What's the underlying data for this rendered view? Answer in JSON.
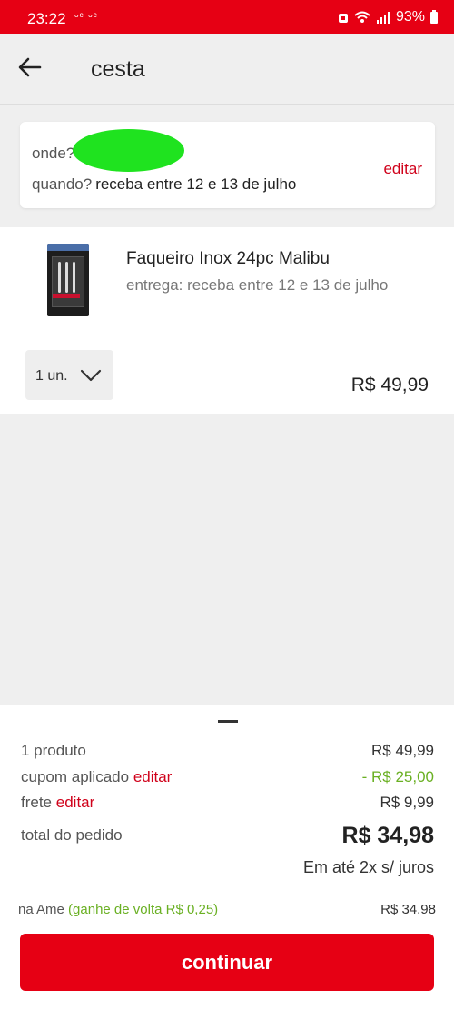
{
  "status_bar": {
    "time": "23:22",
    "notification_icons": "ᵕᶜ ᵕᶜ",
    "battery": "93%"
  },
  "header": {
    "title": "cesta"
  },
  "delivery": {
    "onde_label": "onde?",
    "quando_label": "quando?",
    "quando_value": "receba entre 12 e 13 de julho",
    "edit_label": "editar"
  },
  "product": {
    "name": "Faqueiro Inox 24pc Malibu",
    "delivery": "entrega: receba entre 12 e 13 de julho",
    "quantity": "1 un.",
    "price": "R$ 49,99"
  },
  "summary": {
    "products_label": "1 produto",
    "products_value": "R$ 49,99",
    "coupon_label": "cupom aplicado",
    "coupon_edit": "editar",
    "coupon_value": "- R$ 25,00",
    "shipping_label": "frete",
    "shipping_edit": "editar",
    "shipping_value": "R$ 9,99",
    "total_label": "total do pedido",
    "total_value": "R$ 34,98",
    "installments": "Em até 2x s/ juros",
    "ame_label": "na Ame",
    "ame_cashback": "(ganhe de volta R$ 0,25)",
    "ame_value": "R$ 34,98",
    "continue_label": "continuar"
  },
  "colors": {
    "brand_red": "#e60014",
    "link_red": "#d0021b",
    "discount_green": "#6ab023"
  }
}
